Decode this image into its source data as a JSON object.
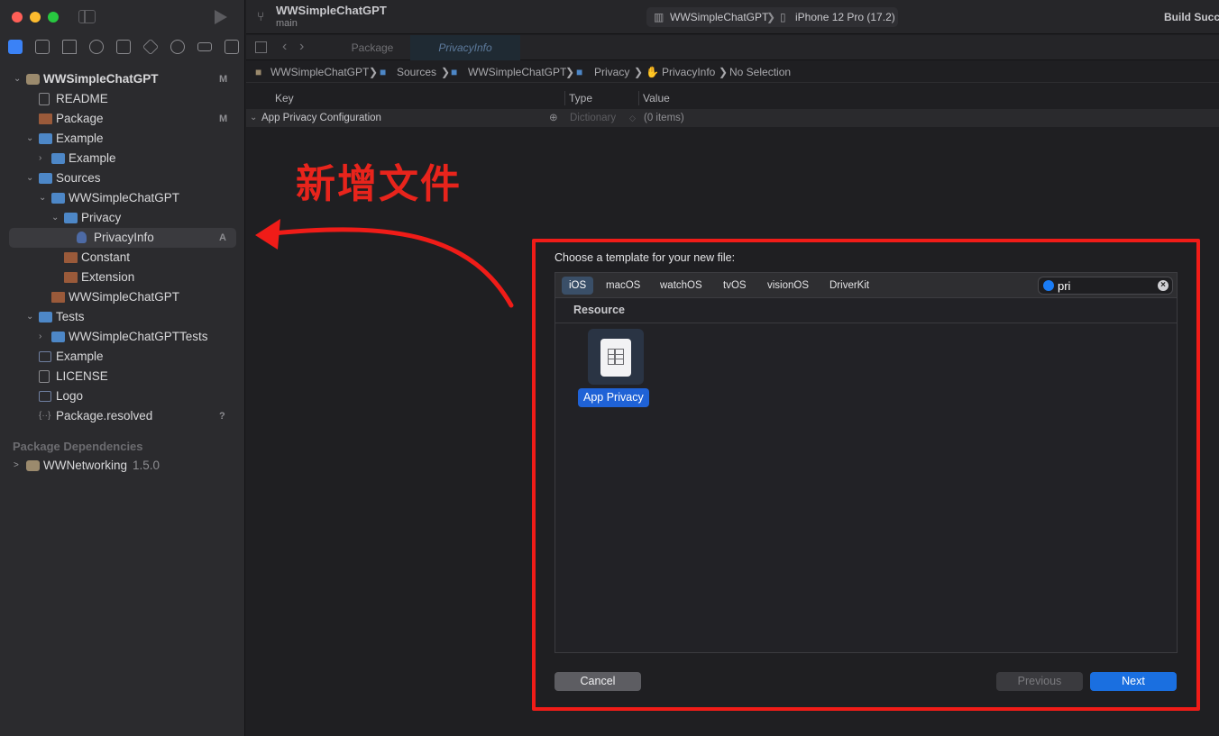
{
  "window": {
    "project_title": "WWSimpleChatGPT",
    "branch": "main",
    "scheme": "WWSimpleChatGPT",
    "device": "iPhone 12 Pro (17.2)",
    "build_status": "Build Succe"
  },
  "tabs": [
    "Package",
    "PrivacyInfo"
  ],
  "breadcrumb": [
    "WWSimpleChatGPT",
    "Sources",
    "WWSimpleChatGPT",
    "Privacy",
    "PrivacyInfo",
    "No Selection"
  ],
  "plist": {
    "headers": [
      "Key",
      "Type",
      "Value"
    ],
    "rows": [
      {
        "key": "App Privacy Configuration",
        "type": "Dictionary",
        "value": "(0 items)"
      }
    ]
  },
  "navigator": {
    "items": [
      {
        "label": "WWSimpleChatGPT",
        "badge": "M",
        "icon": "package-icon"
      },
      {
        "label": "README",
        "badge": "",
        "icon": "book-icon"
      },
      {
        "label": "Package",
        "badge": "M",
        "icon": "swift-icon"
      },
      {
        "label": "Example",
        "badge": "",
        "icon": "folder-icon"
      },
      {
        "label": "Example",
        "badge": "",
        "icon": "folder-icon"
      },
      {
        "label": "Sources",
        "badge": "",
        "icon": "folder-icon"
      },
      {
        "label": "WWSimpleChatGPT",
        "badge": "",
        "icon": "folder-icon"
      },
      {
        "label": "Privacy",
        "badge": "",
        "icon": "folder-icon"
      },
      {
        "label": "PrivacyInfo",
        "badge": "A",
        "icon": "hand-icon"
      },
      {
        "label": "Constant",
        "badge": "",
        "icon": "swift-icon"
      },
      {
        "label": "Extension",
        "badge": "",
        "icon": "swift-icon"
      },
      {
        "label": "WWSimpleChatGPT",
        "badge": "",
        "icon": "swift-icon"
      },
      {
        "label": "Tests",
        "badge": "",
        "icon": "folder-icon"
      },
      {
        "label": "WWSimpleChatGPTTests",
        "badge": "",
        "icon": "folder-icon"
      },
      {
        "label": "Example",
        "badge": "",
        "icon": "image-icon"
      },
      {
        "label": "LICENSE",
        "badge": "",
        "icon": "document-icon"
      },
      {
        "label": "Logo",
        "badge": "",
        "icon": "image-icon"
      },
      {
        "label": "Package.resolved",
        "badge": "?",
        "icon": "json-icon"
      }
    ],
    "dependencies_header": "Package Dependencies",
    "dependency": {
      "label": "WWNetworking",
      "version": "1.5.0"
    }
  },
  "annotation": {
    "text": "新增文件",
    "color": "#e8241c"
  },
  "dialog": {
    "title": "Choose a template for your new file:",
    "platforms": [
      "iOS",
      "macOS",
      "watchOS",
      "tvOS",
      "visionOS",
      "DriverKit"
    ],
    "selected_platform": "iOS",
    "search_value": "pri",
    "section": "Resource",
    "template": "App Privacy",
    "cancel": "Cancel",
    "previous": "Previous",
    "next": "Next"
  },
  "colors": {
    "accent": "#1a6fe0",
    "highlight_box": "#f01c18"
  }
}
